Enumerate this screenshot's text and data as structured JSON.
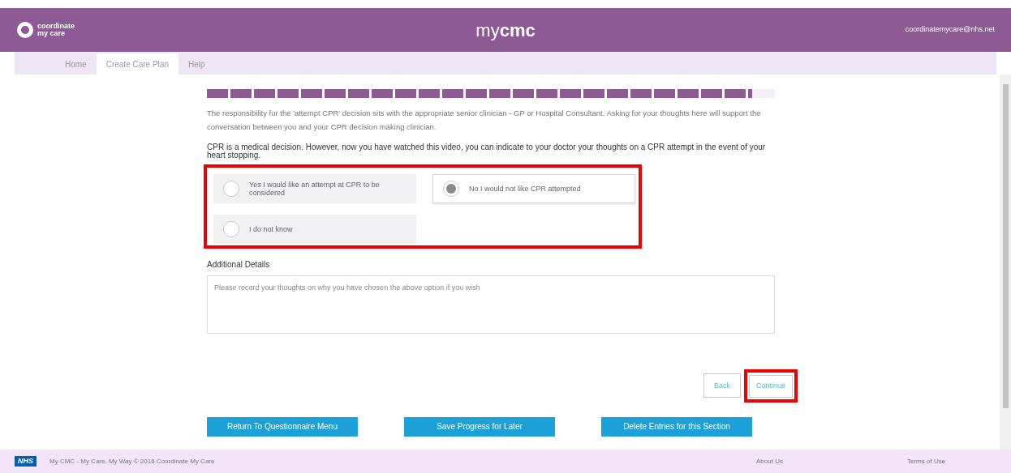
{
  "header": {
    "logo_text": "coordinate my care",
    "title_light": "my",
    "title_bold": "cmc",
    "user": "coordinatemycare@nhs.net"
  },
  "tabs": [
    {
      "label": "Home",
      "selected": false
    },
    {
      "label": "Create Care Plan",
      "selected": true
    },
    {
      "label": "Help",
      "selected": false
    }
  ],
  "progress": {
    "level": 0.96
  },
  "intro": "The responsibility for the 'attempt CPR' decision sits with the appropriate senior clinician - GP or Hospital Consultant. Asking for your thoughts here will support the conversation between you and your CPR decision making clinician.",
  "question": "CPR is a medical decision. However, now you have watched this video, you can indicate to your doctor your thoughts on a CPR attempt in the event of your heart stopping.",
  "options": [
    {
      "label": "Yes I would like an attempt at CPR to be considered",
      "selected": false
    },
    {
      "label": "No I would not like CPR attempted",
      "selected": true
    },
    {
      "label": "I do not know",
      "selected": false
    }
  ],
  "details": {
    "label": "Additional Details",
    "placeholder": "Please record your thoughts on why you have chosen the above option if you wish"
  },
  "nav_buttons": [
    "Back",
    "Continue"
  ],
  "action_buttons": [
    "Return To Questionnaire Menu",
    "Save Progress for Later",
    "Delete Entries for this Section"
  ],
  "footer": {
    "logo": "NHS",
    "copyright": "My CMC - My Care, My Way © 2016 Coordinate My Care",
    "links": [
      "About Us",
      "Terms of Use"
    ]
  }
}
